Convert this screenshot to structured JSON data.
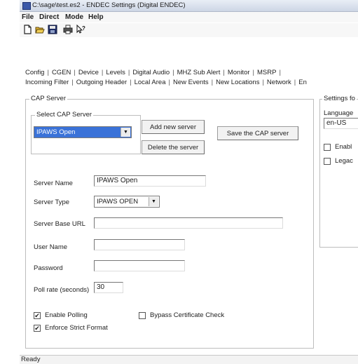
{
  "window": {
    "title": "C:\\sage\\test.es2 - ENDEC Settings (Digital ENDEC)"
  },
  "menu": [
    "File",
    "Direct",
    "Mode",
    "Help"
  ],
  "toolbar": {
    "icons": [
      "new-file-icon",
      "open-folder-icon",
      "save-icon",
      "print-icon",
      "help-pointer-icon"
    ]
  },
  "tabs": {
    "row1": [
      "Config",
      "CGEN",
      "Device",
      "Levels",
      "Digital Audio",
      "MHZ Sub Alert",
      "Monitor",
      "MSRP"
    ],
    "row2": [
      "Incoming Filter",
      "Outgoing Header",
      "Local Area",
      "New Events",
      "New Locations",
      "Network",
      "En"
    ]
  },
  "cap_server": {
    "group_title": "CAP Server",
    "select_group_title": "Select CAP Server",
    "selected": "IPAWS Open",
    "add_button": "Add new server",
    "delete_button": "Delete the server",
    "save_button": "Save the CAP server",
    "server_name_label": "Server Name",
    "server_name_value": "IPAWS Open",
    "server_type_label": "Server Type",
    "server_type_value": "IPAWS OPEN",
    "base_url_label": "Server Base URL",
    "base_url_value": "",
    "user_name_label": "User Name",
    "user_name_value": "",
    "password_label": "Password",
    "password_value": "",
    "poll_rate_label": "Poll rate (seconds)",
    "poll_rate_value": "30",
    "enable_polling_label": "Enable Polling",
    "enable_polling_checked": true,
    "bypass_cert_label": "Bypass Certificate Check",
    "bypass_cert_checked": false,
    "enforce_format_label": "Enforce Strict Format",
    "enforce_format_checked": true
  },
  "settings_panel": {
    "title": "Settings fo",
    "language_label": "Language",
    "language_value": "en-US",
    "check1_label": "Enabl",
    "check2_label": "Legac"
  },
  "status": {
    "text": "Ready"
  },
  "colors": {
    "selection": "#3a72d8",
    "titlebar": "#cdd6e5"
  }
}
